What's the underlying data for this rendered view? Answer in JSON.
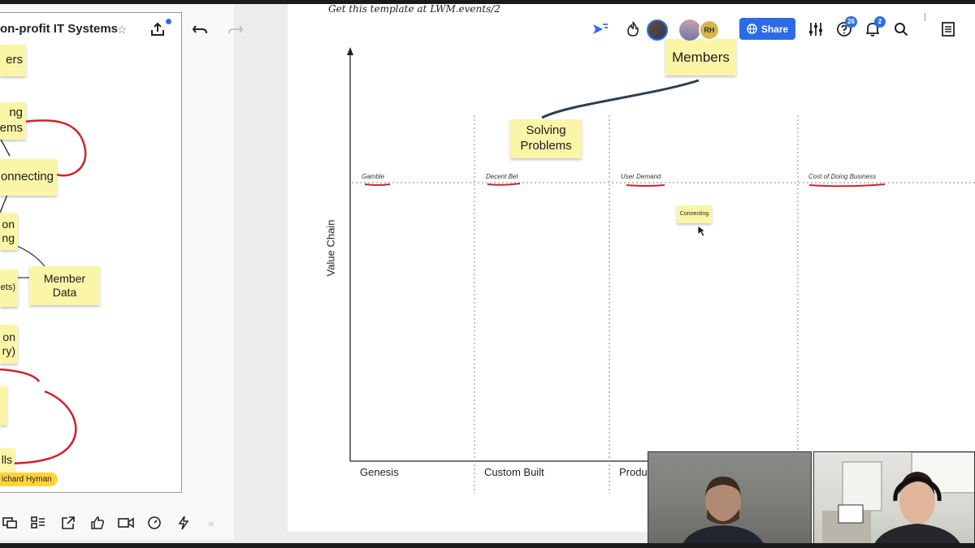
{
  "left_board": {
    "title": "on-profit IT Systems",
    "notes": {
      "members": "ers",
      "problems_a": "ng",
      "problems_b": "ems",
      "connecting": "onnecting",
      "partial_a": "on",
      "partial_b": "ng",
      "member_data_a": "Member",
      "member_data_b": "Data",
      "sheets": "ets)",
      "partial_c": "on",
      "partial_d": "ry)",
      "calls": "lls"
    },
    "user_tag": "ichard Hyman"
  },
  "main_board": {
    "template_note": "Get this template at LWM.events/2",
    "stickies": {
      "members": "Members",
      "solving_a": "Solving",
      "solving_b": "Problems",
      "connecting": "Connecting"
    },
    "y_axis_label": "Value Chain",
    "quadrant_labels": [
      "Gamble",
      "Decent Bet",
      "User Demand",
      "Cost of Doing Business"
    ],
    "x_axis_labels": [
      "Genesis",
      "Custom Built",
      "Produ"
    ]
  },
  "header": {
    "share_label": "Share",
    "help_count": "26",
    "notification_count": "2",
    "avatar_initials": "RH"
  },
  "colors": {
    "sticky": "#fbf5a8",
    "share": "#2c6be6",
    "annotation_red": "#d3202a",
    "connector": "#2c3e50"
  }
}
